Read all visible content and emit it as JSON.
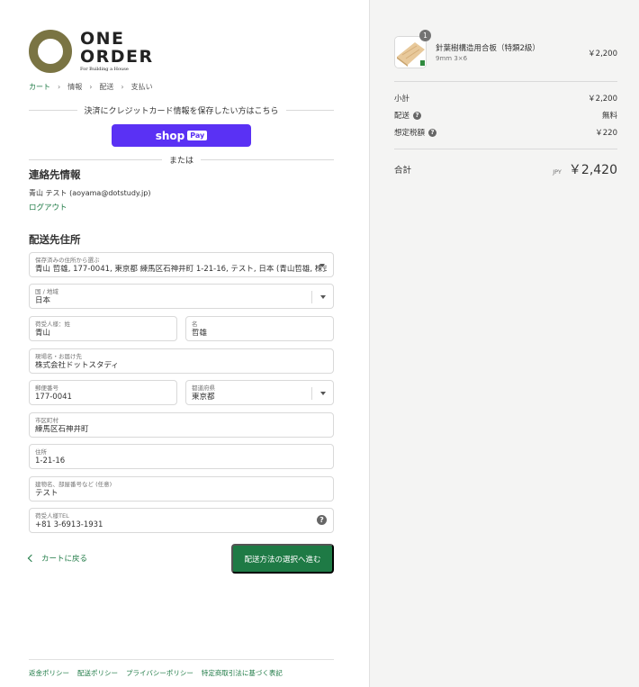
{
  "brand": {
    "line1": "ONE",
    "line2": "ORDER",
    "tagline": "For Building a House",
    "accent": "#7a7443"
  },
  "breadcrumb": [
    "カート",
    "情報",
    "配送",
    "支払い"
  ],
  "express": {
    "prompt": "決済にクレジットカード情報を保存したい方はこちら",
    "shop_pay_text": "shop",
    "shop_pay_badge": "Pay",
    "or_text": "または"
  },
  "contact": {
    "title": "連絡先情報",
    "account": "青山 テスト (aoyama@dotstudy.jp)",
    "logout": "ログアウト"
  },
  "shipping": {
    "title": "配送先住所",
    "saved": {
      "label": "保存済みの住所から選ぶ",
      "value": "青山 哲雄, 177-0041, 東京都 練馬区石神井町 1-21-16, テスト, 日本 (青山哲雄, 株式会社ドットスタディ)"
    },
    "country": {
      "label": "国 / 地域",
      "value": "日本"
    },
    "last_name": {
      "label": "荷受人様：姓",
      "value": "青山"
    },
    "first_name": {
      "label": "名",
      "value": "哲雄"
    },
    "company": {
      "label": "現場名・お届け先",
      "value": "株式会社ドットスタディ"
    },
    "postal": {
      "label": "郵便番号",
      "value": "177-0041"
    },
    "prefecture": {
      "label": "都道府県",
      "value": "東京都"
    },
    "city": {
      "label": "市区町村",
      "value": "練馬区石神井町"
    },
    "address": {
      "label": "住所",
      "value": "1-21-16"
    },
    "building": {
      "label": "建物名、部屋番号など (任意)",
      "value": "テスト"
    },
    "phone": {
      "label": "荷受人様TEL",
      "value": "+81 3-6913-1931"
    }
  },
  "actions": {
    "back": "カートに戻る",
    "continue": "配送方法の選択へ進む",
    "primary_color": "#1e7a45"
  },
  "footer": [
    "返金ポリシー",
    "配送ポリシー",
    "プライバシーポリシー",
    "特定商取引法に基づく表記"
  ],
  "order": {
    "product": {
      "name": "針葉樹構造用合板（特類2級）",
      "variant": "9mm 3×6",
      "price": "￥2,200",
      "quantity": "1"
    },
    "subtotal": {
      "label": "小計",
      "value": "￥2,200"
    },
    "shipping": {
      "label": "配送",
      "value": "無料"
    },
    "tax": {
      "label": "想定税額",
      "value": "￥220"
    },
    "total": {
      "label": "合計",
      "currency": "JPY",
      "value": "￥2,420"
    }
  }
}
